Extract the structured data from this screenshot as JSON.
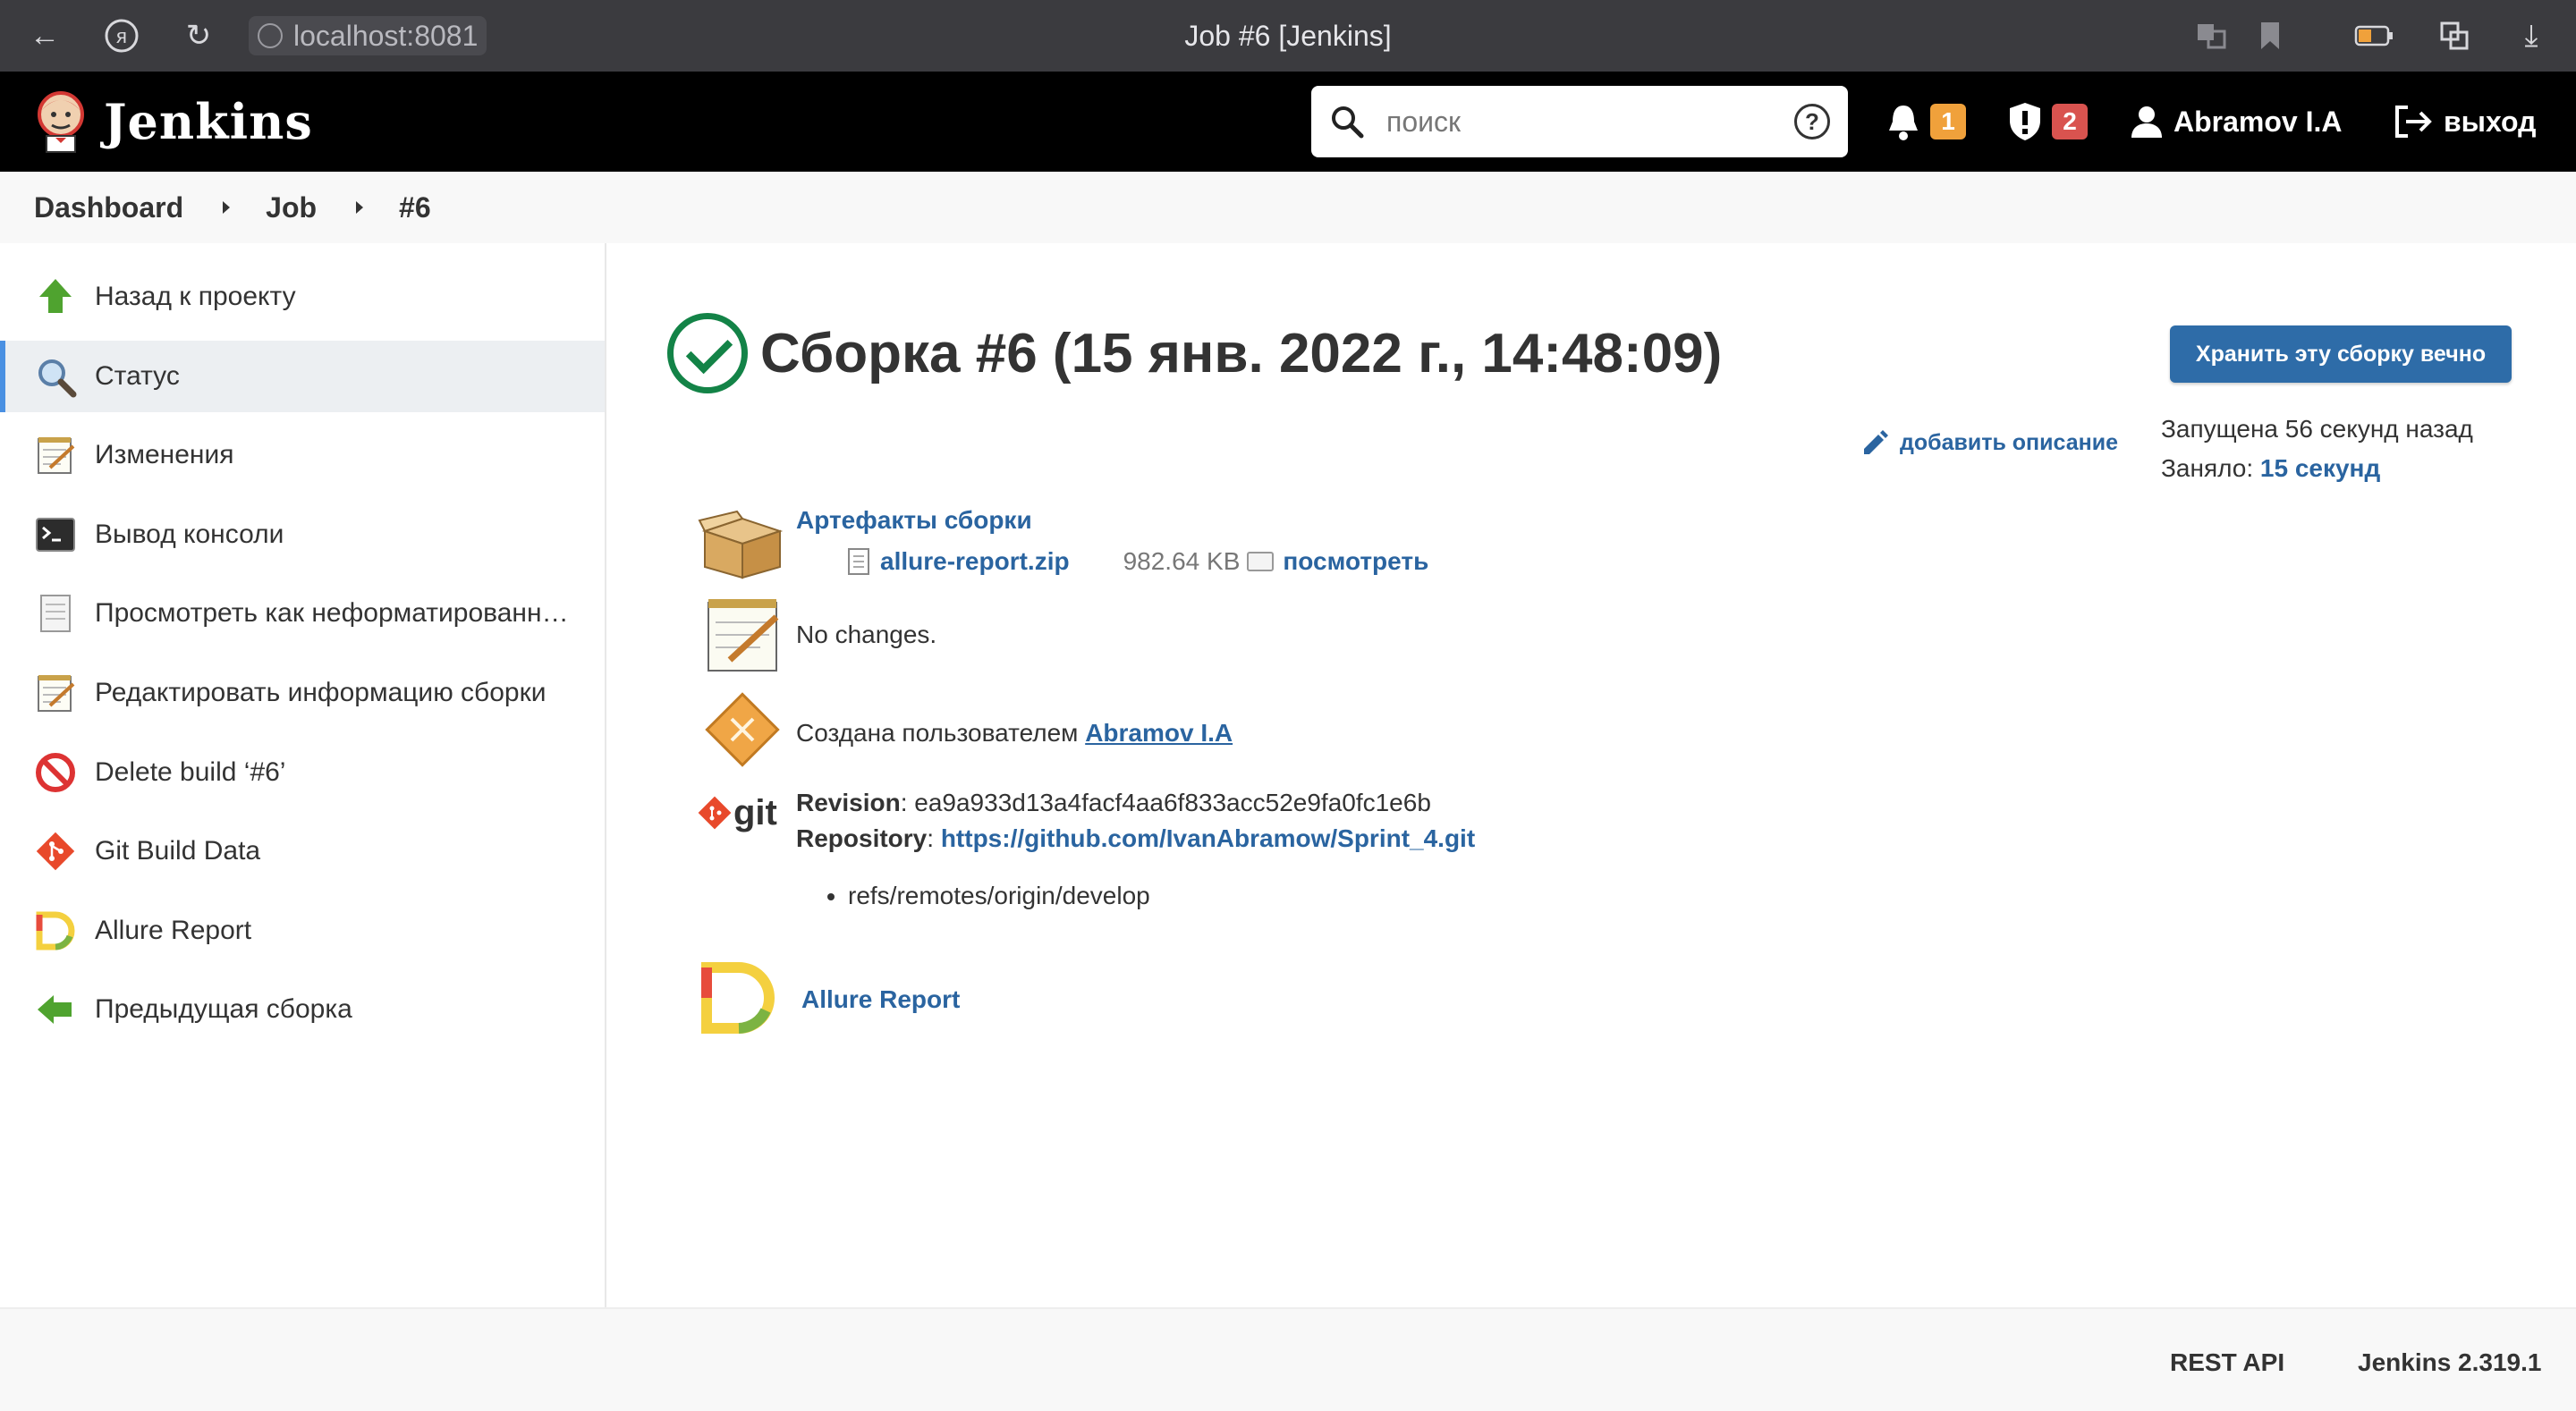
{
  "browser": {
    "url": "localhost:8081",
    "window_title": "Job #6 [Jenkins]"
  },
  "header": {
    "logo_text": "Jenkins",
    "search_placeholder": "поиск",
    "help_label": "?",
    "notifications_count": "1",
    "security_count": "2",
    "user_name": "Abramov I.A",
    "logout_label": "выход",
    "colors": {
      "notification_badge": "#f0a13b",
      "security_badge": "#d9534f"
    }
  },
  "breadcrumb": [
    "Dashboard",
    "Job",
    "#6"
  ],
  "sidebar": {
    "items": [
      {
        "label": "Назад к проекту",
        "icon": "arrow-up-icon"
      },
      {
        "label": "Статус",
        "icon": "magnifier-icon",
        "active": true
      },
      {
        "label": "Изменения",
        "icon": "notepad-icon"
      },
      {
        "label": "Вывод консоли",
        "icon": "terminal-icon"
      },
      {
        "label": "Просмотреть как неформатированн…",
        "icon": "document-icon"
      },
      {
        "label": "Редактировать информацию сборки",
        "icon": "notepad-icon"
      },
      {
        "label": "Delete build ‘#6’",
        "icon": "no-entry-icon"
      },
      {
        "label": "Git Build Data",
        "icon": "git-icon"
      },
      {
        "label": "Allure Report",
        "icon": "allure-icon"
      },
      {
        "label": "Предыдущая сборка",
        "icon": "arrow-left-icon"
      }
    ]
  },
  "build": {
    "title": "Сборка #6 (15 янв. 2022 г., 14:48:09)",
    "keep_button": "Хранить эту сборку вечно",
    "add_description": "добавить описание",
    "started_label": "Запущена 56 секунд назад",
    "took_label": "Заняло:",
    "took_value": "15 секунд",
    "artifacts_title": "Артефакты сборки",
    "artifact_name": "allure-report.zip",
    "artifact_size": "982.64 KB",
    "artifact_view": "посмотреть",
    "changes_text": "No changes.",
    "created_by_label": "Создана пользователем",
    "created_by_user": "Abramov I.A",
    "git_logo_text": "git",
    "revision_label": "Revision",
    "revision_value": "ea9a933d13a4facf4aa6f833acc52e9fa0fc1e6b",
    "repository_label": "Repository",
    "repository_url": "https://github.com/IvanAbramow/Sprint_4.git",
    "refs": [
      "refs/remotes/origin/develop"
    ],
    "allure_link": "Allure Report"
  },
  "footer": {
    "rest_api": "REST API",
    "version": "Jenkins 2.319.1"
  }
}
